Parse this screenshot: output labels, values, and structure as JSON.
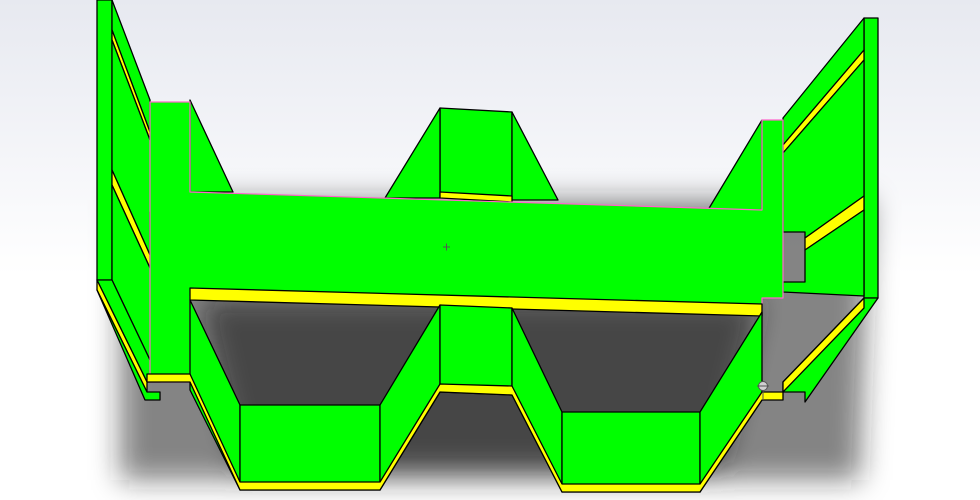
{
  "viewport": {
    "background_top": "#e7e9f0",
    "background_bottom": "#ffffff"
  },
  "model": {
    "face_color": "#00ff00",
    "selected_edge_color": "#ffff00",
    "edge_color": "#000000",
    "shadow_color": "#2a2a2a",
    "highlight_edge_color": "#ff66cc"
  },
  "icons": {
    "origin_marker": "origin-point-icon",
    "triad": "coordinate-triad-icon"
  }
}
